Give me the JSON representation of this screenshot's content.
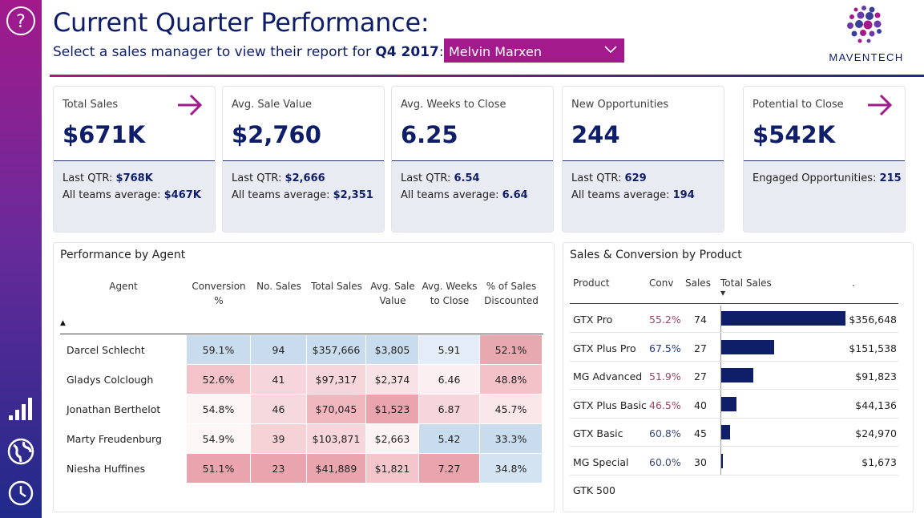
{
  "header": {
    "title": "Current Quarter Performance:",
    "subtitle_prefix": "Select a sales manager to view their report for ",
    "subtitle_quarter": "Q4 2017",
    "subtitle_suffix": ":",
    "manager_select": "Melvin Marxen",
    "logo_text": "MAVENTECH"
  },
  "colors": {
    "brand_magenta": "#a21a8c",
    "brand_navy": "#0f1e68",
    "card_footer": "#e9ebf2"
  },
  "rail": {
    "icons": [
      "help-icon",
      "bar-chart-icon",
      "globe-icon",
      "clock-icon"
    ]
  },
  "kpis": [
    {
      "label": "Total Sales",
      "value": "$671K",
      "arrow": true,
      "lines": [
        {
          "prefix": "Last QTR: ",
          "value": "$768K"
        },
        {
          "prefix": "All teams average: ",
          "value": "$467K"
        }
      ]
    },
    {
      "label": "Avg. Sale Value",
      "value": "$2,760",
      "arrow": false,
      "lines": [
        {
          "prefix": "Last QTR: ",
          "value": "$2,666"
        },
        {
          "prefix": "All teams average: ",
          "value": "$2,351"
        }
      ]
    },
    {
      "label": "Avg. Weeks to Close",
      "value": "6.25",
      "arrow": false,
      "lines": [
        {
          "prefix": "Last QTR: ",
          "value": "6.54"
        },
        {
          "prefix": "All teams average: ",
          "value": "6.64"
        }
      ]
    },
    {
      "label": "New Opportunities",
      "value": "244",
      "arrow": false,
      "lines": [
        {
          "prefix": "Last QTR: ",
          "value": "629"
        },
        {
          "prefix": "All teams average: ",
          "value": "194"
        }
      ]
    },
    {
      "label": "Potential to Close",
      "value": "$542K",
      "arrow": true,
      "lines": [
        {
          "prefix": "Engaged Opportunities: ",
          "value": "215"
        }
      ]
    }
  ],
  "agent_table": {
    "title": "Performance by Agent",
    "columns": [
      "Agent",
      "Conversion %",
      "No. Sales",
      "Total Sales",
      "Avg. Sale Value",
      "Avg. Weeks to Close",
      "% of Sales Discounted"
    ],
    "sort_indicator": "▲",
    "rows": [
      {
        "cells": [
          "Darcel Schlecht",
          "59.1%",
          "94",
          "$357,666",
          "$3,805",
          "5.91",
          "52.1%"
        ],
        "bg": [
          "#ffffff",
          "#c8dcee",
          "#c8dcee",
          "#c8dcee",
          "#c8dcee",
          "#e4edf7",
          "#e8a8b0"
        ]
      },
      {
        "cells": [
          "Gladys Colclough",
          "52.6%",
          "41",
          "$97,317",
          "$2,374",
          "6.46",
          "48.8%"
        ],
        "bg": [
          "#ffffff",
          "#f4c3c9",
          "#f6d6da",
          "#f6d6da",
          "#f8e2e5",
          "#fbeff1",
          "#f2c2c8"
        ]
      },
      {
        "cells": [
          "Jonathan Berthelot",
          "54.8%",
          "46",
          "$70,045",
          "$1,523",
          "6.87",
          "45.7%"
        ],
        "bg": [
          "#ffffff",
          "#fdf6f7",
          "#f6d9dd",
          "#f0b7bf",
          "#eaa4ae",
          "#f6d6da",
          "#fae7ea"
        ]
      },
      {
        "cells": [
          "Marty Freudenburg",
          "54.9%",
          "39",
          "$103,871",
          "$2,663",
          "5.42",
          "33.3%"
        ],
        "bg": [
          "#ffffff",
          "#fdf7f8",
          "#f5d2d6",
          "#f6d6da",
          "#fdf3f4",
          "#c8dcee",
          "#c8dcee"
        ]
      },
      {
        "cells": [
          "Niesha Huffines",
          "51.1%",
          "23",
          "$41,889",
          "$1,821",
          "7.27",
          "34.8%"
        ],
        "bg": [
          "#ffffff",
          "#eaa4ae",
          "#eaa4ae",
          "#eaa4ae",
          "#f3c6cc",
          "#eaa4ae",
          "#d4e3f1"
        ]
      }
    ]
  },
  "product_table": {
    "title": "Sales & Conversion by Product",
    "columns": [
      "Product",
      "Conv",
      "Sales",
      "Total Sales",
      "."
    ],
    "sort_indicator": "▼",
    "rows": [
      {
        "product": "GTX Pro",
        "conv": "55.2%",
        "conv_color": "#a0456a",
        "sales": "74",
        "total": 356648,
        "total_label": "$356,648"
      },
      {
        "product": "GTX Plus Pro",
        "conv": "67.5%",
        "conv_color": "#1f3d8a",
        "sales": "27",
        "total": 151538,
        "total_label": "$151,538"
      },
      {
        "product": "MG Advanced",
        "conv": "51.9%",
        "conv_color": "#a0456a",
        "sales": "27",
        "total": 91823,
        "total_label": "$91,823"
      },
      {
        "product": "GTX Plus Basic",
        "conv": "46.5%",
        "conv_color": "#a0456a",
        "sales": "40",
        "total": 44136,
        "total_label": "$44,136"
      },
      {
        "product": "GTX Basic",
        "conv": "60.8%",
        "conv_color": "#3b4a7a",
        "sales": "45",
        "total": 24970,
        "total_label": "$24,970"
      },
      {
        "product": "MG Special",
        "conv": "60.0%",
        "conv_color": "#3b4a7a",
        "sales": "30",
        "total": 1673,
        "total_label": "$1,673"
      },
      {
        "product": "GTK 500",
        "conv": "",
        "conv_color": "#3b4a7a",
        "sales": "",
        "total": 0,
        "total_label": ""
      }
    ],
    "max_total": 356648
  }
}
